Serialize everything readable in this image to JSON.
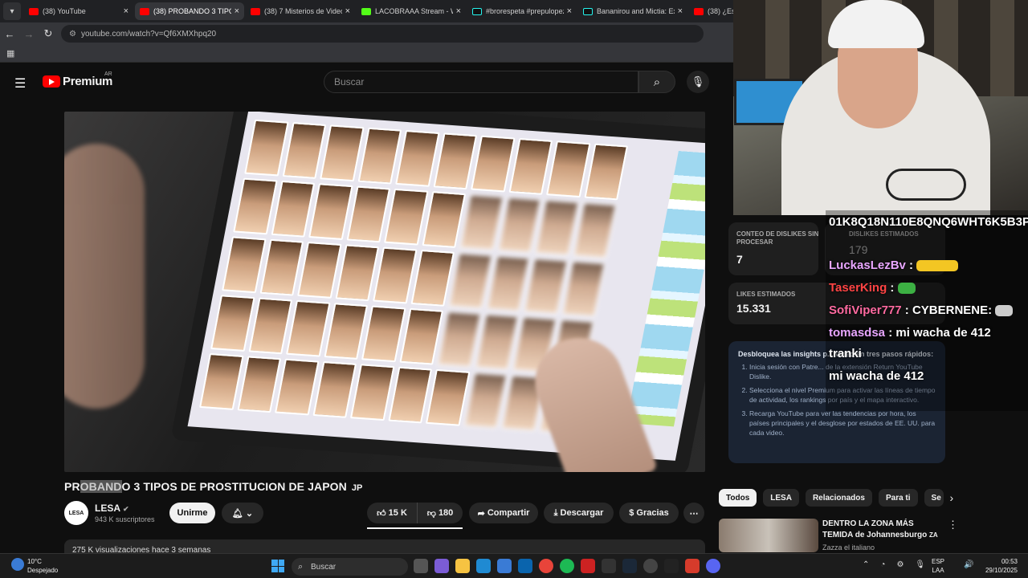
{
  "browser": {
    "tabs": [
      {
        "label": "(38) YouTube",
        "icon": "youtube"
      },
      {
        "label": "(38) PROBANDO 3 TIPOS",
        "icon": "youtube"
      },
      {
        "label": "(38) 7 Misterios de Video",
        "icon": "youtube"
      },
      {
        "label": "LACOBRAAA Stream - Wa",
        "icon": "kick"
      },
      {
        "label": "#brorespeta #prepulopez",
        "icon": "tiktok"
      },
      {
        "label": "Bananirou and Mictia: Exc",
        "icon": "tiktok"
      },
      {
        "label": "(38) ¿Es p",
        "icon": "youtube"
      }
    ],
    "url": "youtube.com/watch?v=Qf6XMXhpq20"
  },
  "youtube": {
    "logo_text": "Premium",
    "country": "AR",
    "search_placeholder": "Buscar",
    "video_title_prefix": "PR",
    "video_title_highlight": "OBAND",
    "video_title_rest": "O 3 TIPOS DE PROSTITUCION DE JAPON",
    "video_title_flag": "JP",
    "channel": {
      "name": "LESA",
      "subs": "943 K suscriptores",
      "avatar_text": "LESA"
    },
    "buttons": {
      "join": "Unirme",
      "likes": "15 K",
      "dislikes": "180",
      "share": "Compartir",
      "download": "Descargar",
      "thanks": "Gracias"
    },
    "description_preview": "275 K visualizaciones  hace 3 semanas"
  },
  "dislike_panel": {
    "raw_label": "CONTEO DE DISLIKES SIN PROCESAR",
    "raw_value": "7",
    "est_label": "DISLIKES ESTIMADOS",
    "est_value": "179",
    "likes_label": "LIKES ESTIMADOS",
    "likes_value": "15.331",
    "insight_title": "Desbloquea las insights p... video en tres pasos rápidos:",
    "steps": [
      "Inicia sesión con Patre... de la extensión Return YouTube Dislike.",
      "Selecciona el nivel Premium para activar las líneas de tiempo de actividad, los rankings por país y el mapa interactivo.",
      "Recarga YouTube para ver las tendencias por hora, los países principales y el desglose por estados de EE. UU. para cada video."
    ]
  },
  "chips": [
    "Todos",
    "LESA",
    "Relacionados",
    "Para ti",
    "Se"
  ],
  "recommended": {
    "title": "DENTRO LA ZONA MÁS TEMIDA de Johannesburgo",
    "flag": "ZA",
    "channel": "Zazza el italiano"
  },
  "chat": [
    {
      "user": "",
      "text": "01K8Q18N110E8QNQ6WHT6K5B3P"
    },
    {
      "user": "LuckasLezBv",
      "text": ":"
    },
    {
      "user": "TaserKing",
      "text": ":"
    },
    {
      "user": "SofiViper777",
      "text": ": CYBERNENE:"
    },
    {
      "user": "tomasdsa",
      "text": ": mi wacha de 412"
    },
    {
      "user": "",
      "text": "tranki"
    },
    {
      "user": "",
      "text": "mi wacha de 412"
    }
  ],
  "taskbar": {
    "temp": "10°C",
    "weather": "Despejado",
    "search": "Buscar",
    "lang1": "ESP",
    "lang2": "LAA",
    "time": "00:53",
    "date": "29/10/2025"
  },
  "colors": {
    "youtube_red": "#ff0000",
    "chat_user": "#e8a6ff",
    "insight_bg": "#1b2433"
  }
}
